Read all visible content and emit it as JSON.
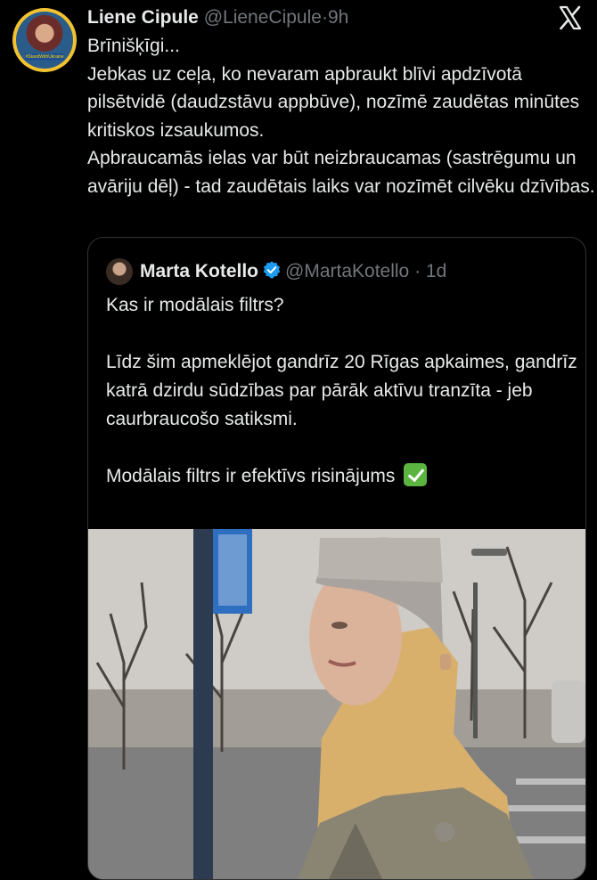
{
  "tweet": {
    "author_name": "Liene Cipule",
    "author_handle": "@LieneCipule",
    "separator": "·",
    "time": "9h",
    "avatar_badge": "#StandWithUkraine",
    "text": "Brīnišķīgi...\nJebkas uz ceļa, ko nevaram apbraukt blīvi apdzīvotā pilsētvidē (daudzstāvu appbūve), nozīmē zaudētas minūtes kritiskos izsaukumos.\nApbraucamās ielas var būt neizbraucamas (sastrēgumu un avāriju dēļ) - tad zaudētais laiks var nozīmēt cilvēku dzīvības."
  },
  "quoted_tweet": {
    "author_name": "Marta Kotello",
    "author_handle": "@MartaKotello",
    "separator": "·",
    "time": "1d",
    "text": "Kas ir modālais filtrs?\n\nLīdz šim apmeklējot gandrīz 20 Rīgas apkaimes, gandrīz katrā dzirdu sūdzības par pārāk aktīvu tranzīta - jeb caurbraucošo satiksmi.\n\nModālais filtrs ir efektīvs risinājums"
  },
  "icons": {
    "close": "x-logo-icon",
    "verified": "verified-badge-icon",
    "check": "check-mark-emoji-icon"
  },
  "colors": {
    "background": "#000000",
    "text": "#e7e9ea",
    "muted": "#71767b",
    "verified": "#1d9bf0",
    "check_emoji": "#5bb440"
  }
}
